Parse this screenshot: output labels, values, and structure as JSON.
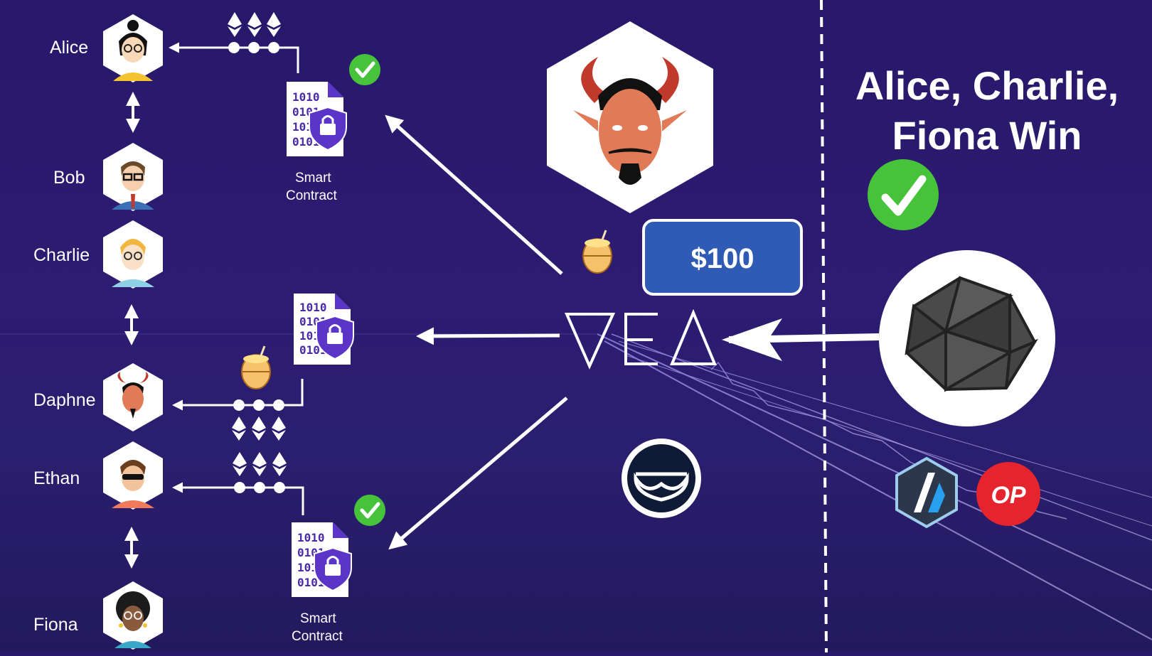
{
  "participants": [
    {
      "id": "alice",
      "label": "Alice"
    },
    {
      "id": "bob",
      "label": "Bob"
    },
    {
      "id": "charlie",
      "label": "Charlie"
    },
    {
      "id": "daphne",
      "label": "Daphne"
    },
    {
      "id": "ethan",
      "label": "Ethan"
    },
    {
      "id": "fiona",
      "label": "Fiona"
    }
  ],
  "contracts": {
    "binary_lines": [
      "1010",
      "0101",
      "1010",
      "0101"
    ],
    "caption_line1": "Smart",
    "caption_line2": "Contract"
  },
  "bridge": {
    "logo_text": "ᐁEᐃ",
    "bond_amount": "$100"
  },
  "result": {
    "title_line1": "Alice, Charlie,",
    "title_line2": "Fiona Win"
  },
  "networks": {
    "optimism_label": "OP"
  },
  "colors": {
    "accent_blue": "#2f5bb5",
    "check_green": "#47c33b",
    "contract_purple": "#5b35c8",
    "op_red": "#e5242d"
  }
}
